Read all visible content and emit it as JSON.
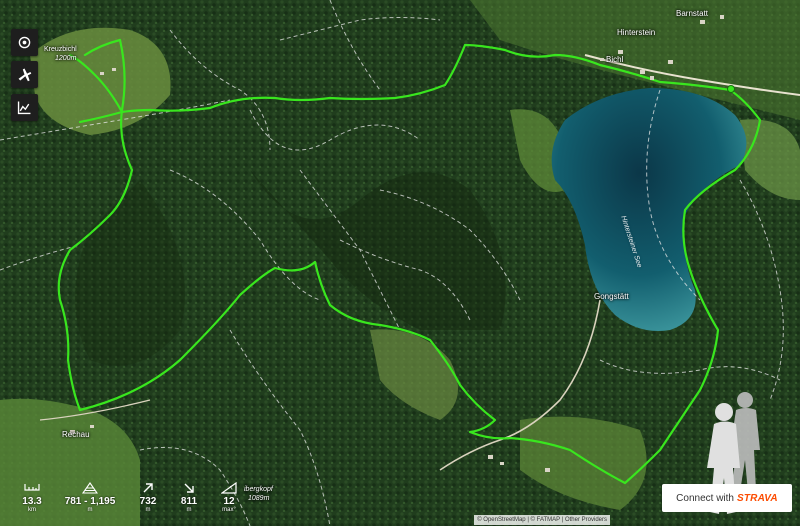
{
  "controls": {
    "locate_icon": "target-icon",
    "flyover_icon": "airplane-icon",
    "elevation_icon": "chart-icon"
  },
  "places": {
    "kreuzbichl_name": "Kreuzbichl",
    "kreuzbichl_elev": "1200m",
    "bichl": "Bichl",
    "hinterstein": "Hinterstein",
    "barnstatt": "Barnstatt",
    "gongstatt": "Gongstätt",
    "rechau": "Rechau",
    "lake": "Hintersteiner See",
    "summit_name": "iberg­kopf",
    "summit_elev": "1089m"
  },
  "stats": {
    "distance": {
      "value": "13.3",
      "unit": "km"
    },
    "elevation_range": {
      "value": "781 - 1,195",
      "unit": "m"
    },
    "ascent": {
      "value": "732",
      "unit": "m"
    },
    "descent": {
      "value": "811",
      "unit": "m"
    },
    "slope": {
      "value": "12",
      "unit": "max°"
    }
  },
  "strava": {
    "prefix": "Connect with",
    "brand": "STRAVA"
  },
  "attribution": "© OpenStreetMap | © FATMAP | Other Providers",
  "colors": {
    "track": "#39e61e",
    "lake": "#0e4f63",
    "forest": "#1f3b1c",
    "meadow": "#5f8a3a"
  }
}
